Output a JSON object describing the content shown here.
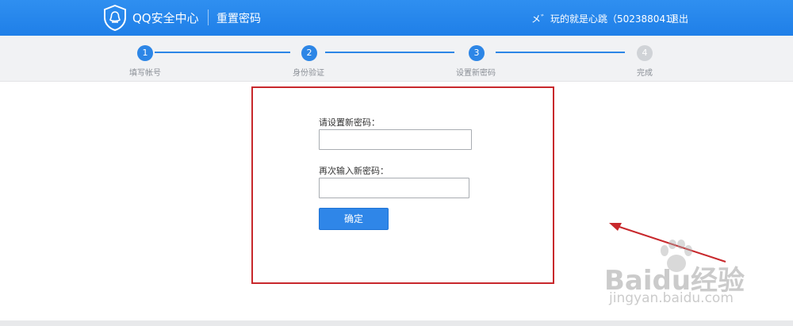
{
  "header": {
    "brand": "QQ安全中心",
    "page_title": "重置密码",
    "user_info": "メ゛玩的就是心跳（502388041）",
    "logout_label": "退出"
  },
  "steps": [
    {
      "number": "1",
      "label": "填写帐号",
      "state": "done"
    },
    {
      "number": "2",
      "label": "身份验证",
      "state": "done"
    },
    {
      "number": "3",
      "label": "设置新密码",
      "state": "current"
    },
    {
      "number": "4",
      "label": "完成",
      "state": "pending"
    }
  ],
  "form": {
    "new_password_label": "请设置新密码：",
    "new_password_value": "",
    "confirm_password_label": "再次输入新密码：",
    "confirm_password_value": "",
    "confirm_button_label": "确定"
  },
  "watermark": {
    "brand": "Baidu经验",
    "url": "jingyan.baidu.com"
  },
  "colors": {
    "header_blue": "#2586ec",
    "step_active": "#2d86e6",
    "step_inactive": "#d0d3d7",
    "annotation_red": "#c8282c"
  }
}
